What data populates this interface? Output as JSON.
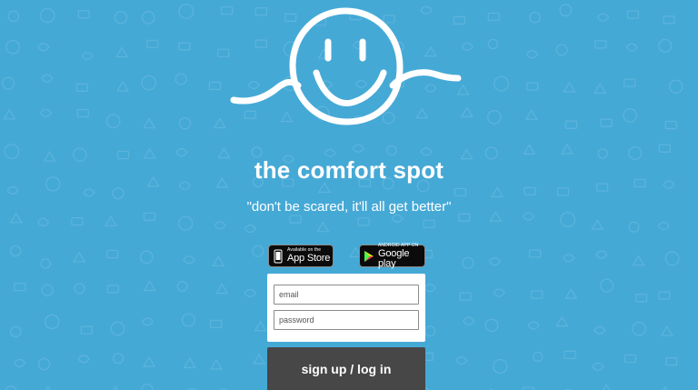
{
  "app": {
    "title": "the comfort spot",
    "tagline": "\"don't be scared, it'll all get better\""
  },
  "badges": {
    "apple": {
      "small": "Available on the",
      "big": "App Store",
      "icon": "apple-icon"
    },
    "google": {
      "small": "ANDROID APP ON",
      "big": "Google play",
      "icon": "google-play-icon"
    }
  },
  "form": {
    "email": {
      "placeholder": "email",
      "value": ""
    },
    "password": {
      "placeholder": "password",
      "value": ""
    },
    "submit_label": "sign up / log in"
  },
  "colors": {
    "background": "#45a9d6",
    "button": "#474747",
    "text": "#ffffff"
  }
}
